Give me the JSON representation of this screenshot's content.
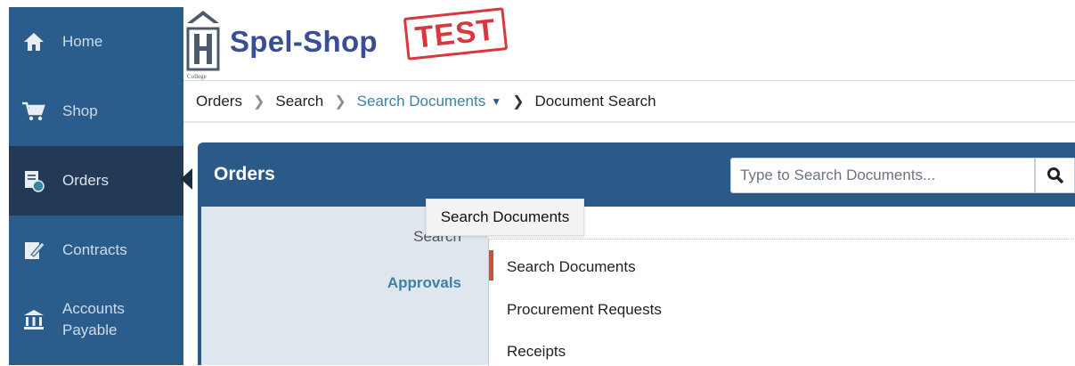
{
  "sidebar": {
    "items": [
      {
        "label": "Home",
        "icon": "home-icon"
      },
      {
        "label": "Shop",
        "icon": "cart-icon"
      },
      {
        "label": "Orders",
        "icon": "orders-icon",
        "active": true
      },
      {
        "label": "Contracts",
        "icon": "contract-icon"
      },
      {
        "label": "Accounts",
        "label2": "Payable",
        "icon": "bank-icon"
      }
    ]
  },
  "header": {
    "brand": "Spel-Shop",
    "stamp": "TEST",
    "logo_caption": "College"
  },
  "breadcrumb": {
    "items": [
      "Orders",
      "Search",
      "Search Documents",
      "Document Search"
    ]
  },
  "panel": {
    "title": "Orders",
    "search_placeholder": "Type to Search Documents...",
    "left_links": [
      "Search",
      "Approvals"
    ]
  },
  "menu": {
    "items": [
      "Search Documents",
      "Procurement Requests",
      "Receipts"
    ]
  },
  "tooltip": {
    "text": "Search Documents"
  },
  "colors": {
    "sidebar": "#2b5d8c",
    "sidebar_active": "#233a57",
    "panel": "#2c5a88",
    "link": "#3b82a8",
    "stamp": "#d9363e",
    "brand": "#3a4e96"
  }
}
